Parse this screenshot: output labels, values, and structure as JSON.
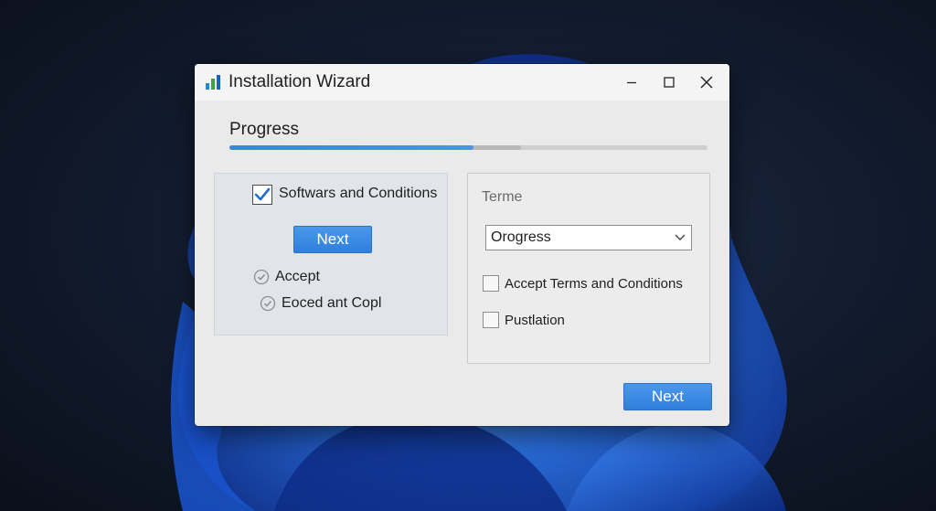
{
  "window": {
    "title": "Installation Wizard",
    "controls": [
      "minimize",
      "maximize",
      "close"
    ]
  },
  "progress": {
    "label": "Progress",
    "value_percent": 51,
    "secondary_percent": 61
  },
  "left_panel": {
    "checkbox_label": "Softwars and Conditions",
    "checkbox_checked": true,
    "next_button": "Next",
    "status_items": [
      {
        "label": "Accept"
      },
      {
        "label": "Eoced ant Copl"
      }
    ]
  },
  "right_panel": {
    "heading": "Terme",
    "select_value": "Orogress",
    "checkboxes": [
      {
        "label": "Accept Terms and Conditions",
        "checked": false
      },
      {
        "label": "Pustlation",
        "checked": false
      }
    ]
  },
  "footer": {
    "next_button": "Next"
  },
  "colors": {
    "accent": "#3a86db",
    "window_bg": "#eaeaea",
    "desktop_bg": "#111a2c",
    "wallpaper_bloom": "#1f5fd6"
  }
}
